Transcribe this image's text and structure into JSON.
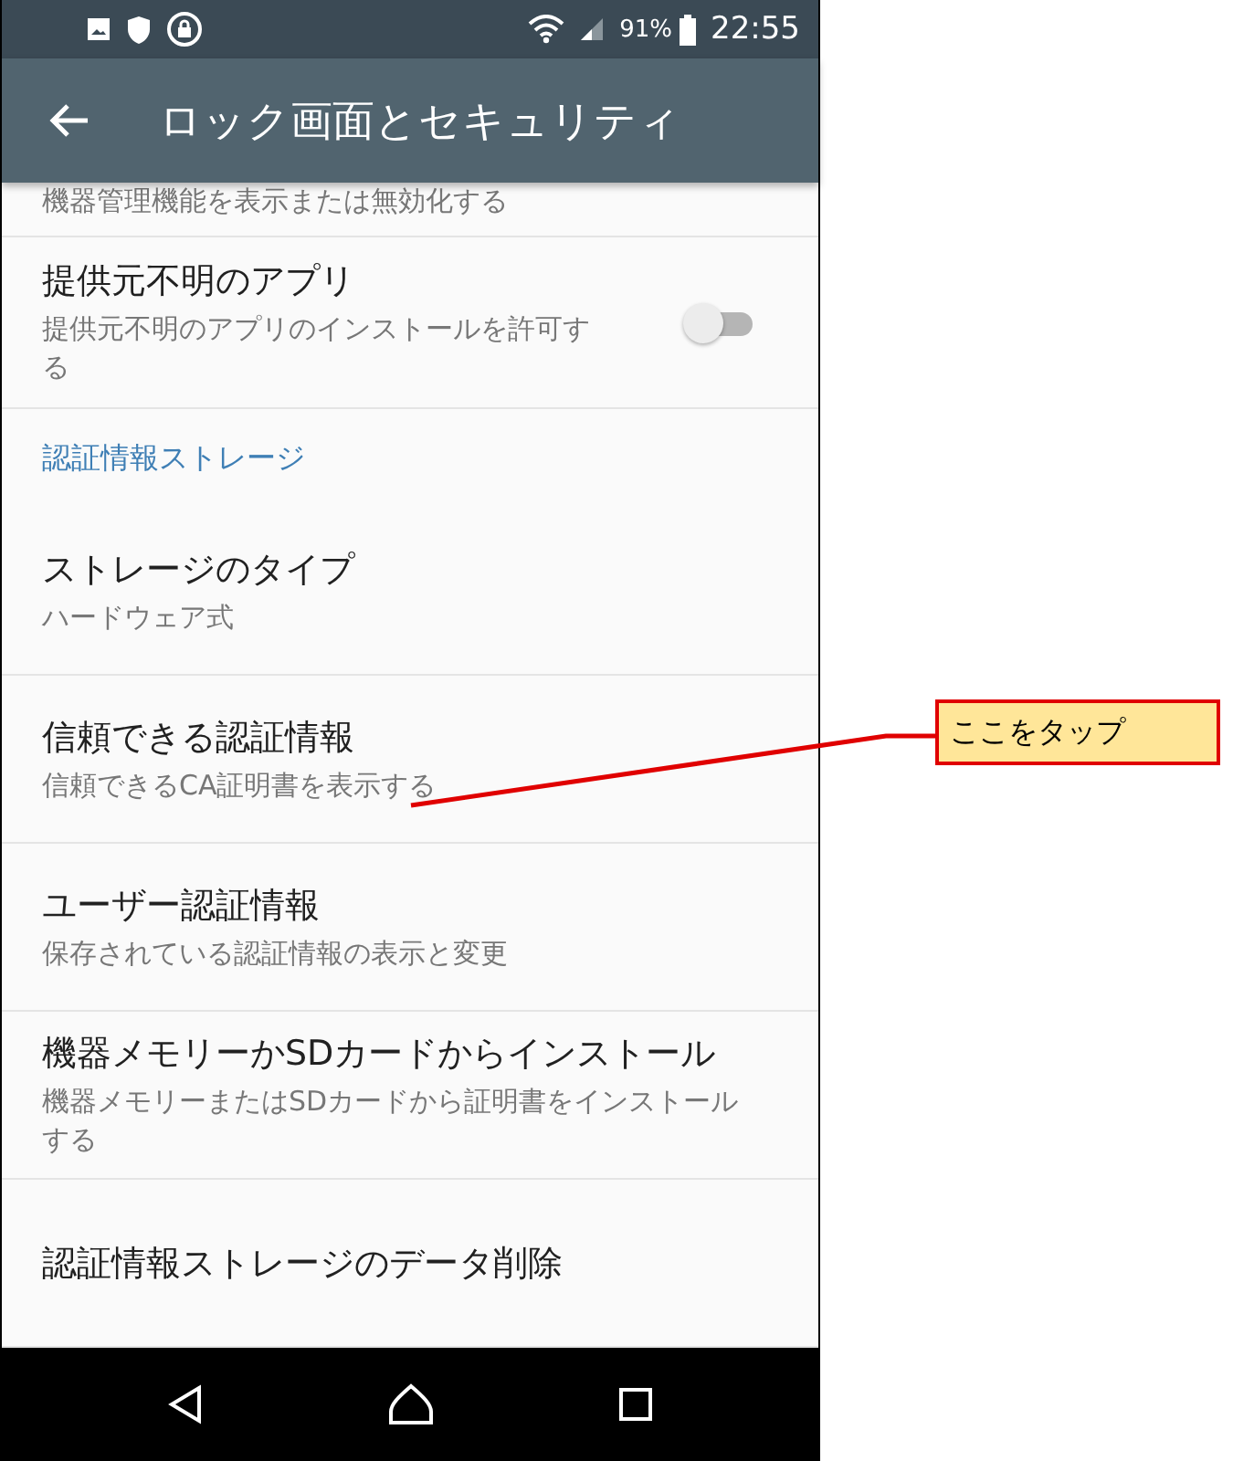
{
  "status_bar": {
    "battery": "91%",
    "time": "22:55"
  },
  "app_bar": {
    "title": "ロック画面とセキュリティ"
  },
  "items": [
    {
      "kind": "partial",
      "summary": "機器管理機能を表示または無効化する"
    },
    {
      "kind": "toggle",
      "title": "提供元不明のアプリ",
      "summary": "提供元不明のアプリのインストールを許可する",
      "on": false
    },
    {
      "kind": "header",
      "title": "認証情報ストレージ"
    },
    {
      "kind": "item",
      "title": "ストレージのタイプ",
      "summary": "ハードウェア式"
    },
    {
      "kind": "item",
      "title": "信頼できる認証情報",
      "summary": "信頼できるCA証明書を表示する"
    },
    {
      "kind": "item",
      "title": "ユーザー認証情報",
      "summary": "保存されている認証情報の表示と変更"
    },
    {
      "kind": "item",
      "title": "機器メモリーかSDカードからインストール",
      "summary": "機器メモリーまたはSDカードから証明書をインストールする"
    },
    {
      "kind": "item",
      "title": "認証情報ストレージのデータ削除"
    }
  ],
  "callout": {
    "text": "ここをタップ"
  }
}
